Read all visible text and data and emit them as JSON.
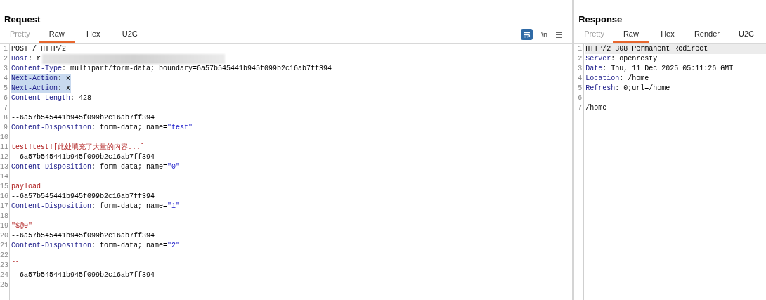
{
  "request": {
    "title": "Request",
    "tabs": [
      {
        "label": "Pretty",
        "selected": false,
        "disabled": true
      },
      {
        "label": "Raw",
        "selected": true,
        "disabled": false
      },
      {
        "label": "Hex",
        "selected": false,
        "disabled": false
      },
      {
        "label": "U2C",
        "selected": false,
        "disabled": false
      }
    ],
    "toolbar": {
      "wrap_on": true,
      "newline_label": "\\n"
    },
    "lines": [
      {
        "number": "1",
        "selected": false,
        "parts": [
          {
            "kind": "plain",
            "text": "POST / HTTP/2"
          }
        ]
      },
      {
        "number": "2",
        "selected": false,
        "parts": [
          {
            "kind": "key",
            "text": "Host"
          },
          {
            "kind": "plain",
            "text": ": r"
          },
          {
            "kind": "redacted"
          }
        ]
      },
      {
        "number": "3",
        "selected": false,
        "parts": [
          {
            "kind": "key",
            "text": "Content-Type"
          },
          {
            "kind": "plain",
            "text": ": multipart/form-data; boundary=6a57b545441b945f099b2c16ab7ff394"
          }
        ]
      },
      {
        "number": "4",
        "selected": true,
        "parts": [
          {
            "kind": "key",
            "text": "Next-Action"
          },
          {
            "kind": "plain",
            "text": ": x"
          }
        ]
      },
      {
        "number": "5",
        "selected": true,
        "parts": [
          {
            "kind": "key",
            "text": "Next-Action"
          },
          {
            "kind": "plain",
            "text": ": x"
          }
        ]
      },
      {
        "number": "6",
        "selected": false,
        "parts": [
          {
            "kind": "key",
            "text": "Content-Length"
          },
          {
            "kind": "plain",
            "text": ": 428"
          }
        ]
      },
      {
        "number": "7",
        "selected": false
      },
      {
        "number": "8",
        "selected": false,
        "parts": [
          {
            "kind": "plain",
            "text": "--6a57b545441b945f099b2c16ab7ff394"
          }
        ]
      },
      {
        "number": "9",
        "selected": false,
        "parts": [
          {
            "kind": "key",
            "text": "Content-Disposition"
          },
          {
            "kind": "plain",
            "text": ": form-data; name="
          },
          {
            "kind": "string",
            "text": "\"test\""
          }
        ]
      },
      {
        "number": "10",
        "selected": false
      },
      {
        "number": "11",
        "selected": false,
        "parts": [
          {
            "kind": "body",
            "text": "test!test![此处填充了大量的内容...]"
          }
        ]
      },
      {
        "number": "12",
        "selected": false,
        "parts": [
          {
            "kind": "plain",
            "text": "--6a57b545441b945f099b2c16ab7ff394"
          }
        ]
      },
      {
        "number": "13",
        "selected": false,
        "parts": [
          {
            "kind": "key",
            "text": "Content-Disposition"
          },
          {
            "kind": "plain",
            "text": ": form-data; name="
          },
          {
            "kind": "string",
            "text": "\"0\""
          }
        ]
      },
      {
        "number": "14",
        "selected": false
      },
      {
        "number": "15",
        "selected": false,
        "parts": [
          {
            "kind": "body",
            "text": "payload"
          }
        ]
      },
      {
        "number": "16",
        "selected": false,
        "parts": [
          {
            "kind": "plain",
            "text": "--6a57b545441b945f099b2c16ab7ff394"
          }
        ]
      },
      {
        "number": "17",
        "selected": false,
        "parts": [
          {
            "kind": "key",
            "text": "Content-Disposition"
          },
          {
            "kind": "plain",
            "text": ": form-data; name="
          },
          {
            "kind": "string",
            "text": "\"1\""
          }
        ]
      },
      {
        "number": "18",
        "selected": false
      },
      {
        "number": "19",
        "selected": false,
        "parts": [
          {
            "kind": "body",
            "text": "\"$@0\""
          }
        ]
      },
      {
        "number": "20",
        "selected": false,
        "parts": [
          {
            "kind": "plain",
            "text": "--6a57b545441b945f099b2c16ab7ff394"
          }
        ]
      },
      {
        "number": "21",
        "selected": false,
        "parts": [
          {
            "kind": "key",
            "text": "Content-Disposition"
          },
          {
            "kind": "plain",
            "text": ": form-data; name="
          },
          {
            "kind": "string",
            "text": "\"2\""
          }
        ]
      },
      {
        "number": "22",
        "selected": false
      },
      {
        "number": "23",
        "selected": false,
        "parts": [
          {
            "kind": "body",
            "text": "[]"
          }
        ]
      },
      {
        "number": "24",
        "selected": false,
        "parts": [
          {
            "kind": "plain",
            "text": "--6a57b545441b945f099b2c16ab7ff394--"
          }
        ]
      },
      {
        "number": "25",
        "selected": false
      }
    ]
  },
  "response": {
    "title": "Response",
    "tabs": [
      {
        "label": "Pretty",
        "selected": false,
        "disabled": true
      },
      {
        "label": "Raw",
        "selected": true,
        "disabled": false
      },
      {
        "label": "Hex",
        "selected": false,
        "disabled": false
      },
      {
        "label": "Render",
        "selected": false,
        "disabled": false
      },
      {
        "label": "U2C",
        "selected": false,
        "disabled": false
      }
    ],
    "lines": [
      {
        "number": "1",
        "current": true,
        "parts": [
          {
            "kind": "plain",
            "text": "HTTP/2 308 Permanent Redirect"
          }
        ]
      },
      {
        "number": "2",
        "current": false,
        "parts": [
          {
            "kind": "key",
            "text": "Server"
          },
          {
            "kind": "plain",
            "text": ": openresty"
          }
        ]
      },
      {
        "number": "3",
        "current": false,
        "parts": [
          {
            "kind": "key",
            "text": "Date"
          },
          {
            "kind": "plain",
            "text": ": Thu, 11 Dec 2025 05:11:26 GMT"
          }
        ]
      },
      {
        "number": "4",
        "current": false,
        "parts": [
          {
            "kind": "key",
            "text": "Location"
          },
          {
            "kind": "plain",
            "text": ": /home"
          }
        ]
      },
      {
        "number": "5",
        "current": false,
        "parts": [
          {
            "kind": "key",
            "text": "Refresh"
          },
          {
            "kind": "plain",
            "text": ": 0;url=/home"
          }
        ]
      },
      {
        "number": "6",
        "current": false
      },
      {
        "number": "7",
        "current": false,
        "parts": [
          {
            "kind": "plain",
            "text": "/home"
          }
        ]
      }
    ]
  }
}
